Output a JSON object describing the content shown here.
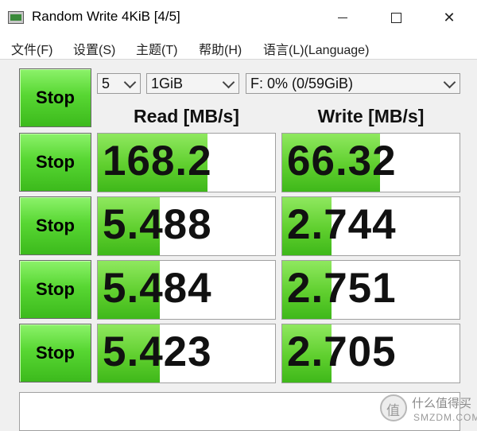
{
  "window": {
    "title": "Random Write 4KiB [4/5]",
    "close_glyph": "✕"
  },
  "menu": [
    "文件(F)",
    "设置(S)",
    "主题(T)",
    "帮助(H)",
    "语言(L)(Language)"
  ],
  "controls": {
    "all_button_label": "Stop",
    "count": "5",
    "size": "1GiB",
    "drive": "F: 0% (0/59GiB)"
  },
  "headers": {
    "read": "Read [MB/s]",
    "write": "Write [MB/s]"
  },
  "rows": [
    {
      "button_label": "Stop",
      "read": "168.2",
      "write": "66.32",
      "read_fill": 0.62,
      "write_fill": 0.55
    },
    {
      "button_label": "Stop",
      "read": "5.488",
      "write": "2.744",
      "read_fill": 0.35,
      "write_fill": 0.28
    },
    {
      "button_label": "Stop",
      "read": "5.484",
      "write": "2.751",
      "read_fill": 0.35,
      "write_fill": 0.28
    },
    {
      "button_label": "Stop",
      "read": "5.423",
      "write": "2.705",
      "read_fill": 0.35,
      "write_fill": 0.28
    }
  ],
  "comment": "",
  "watermark": {
    "line1": "什么值得买",
    "line2": "SMZDM.COM"
  },
  "icons": {
    "app": "crystaldiskmark-icon",
    "minimize": "minimize-icon",
    "maximize": "maximize-icon",
    "close": "close-icon"
  }
}
